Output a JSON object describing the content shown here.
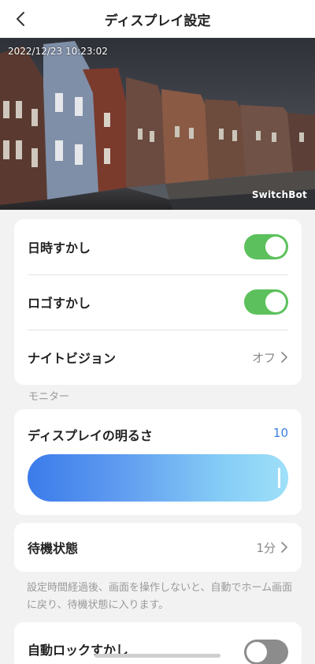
{
  "header": {
    "title": "ディスプレイ設定"
  },
  "camera": {
    "timestamp": "2022/12/23 10:23:02",
    "logo": "SwitchBot"
  },
  "settings": [
    {
      "label": "日時すかし",
      "control": "toggle",
      "on": true
    },
    {
      "label": "ロゴすかし",
      "control": "toggle",
      "on": true
    },
    {
      "label": "ナイトビジョン",
      "value": "オフ"
    }
  ],
  "monitor": {
    "section_label": "モニター",
    "brightness_label": "ディスプレイの明るさ",
    "brightness_value": "10"
  },
  "standby": {
    "label": "待機状態",
    "value": "1分",
    "description": "設定時間経過後、画面を操作しないと、自動でホーム画面に戻り、待機状態に入ります。"
  },
  "auto_row": {
    "label": "自動ロックすかし",
    "control": "toggle",
    "on": false
  },
  "colors": {
    "toggle_on": "#5cc15c",
    "toggle_off": "#8c8c8c",
    "accent": "#3b7de3"
  }
}
